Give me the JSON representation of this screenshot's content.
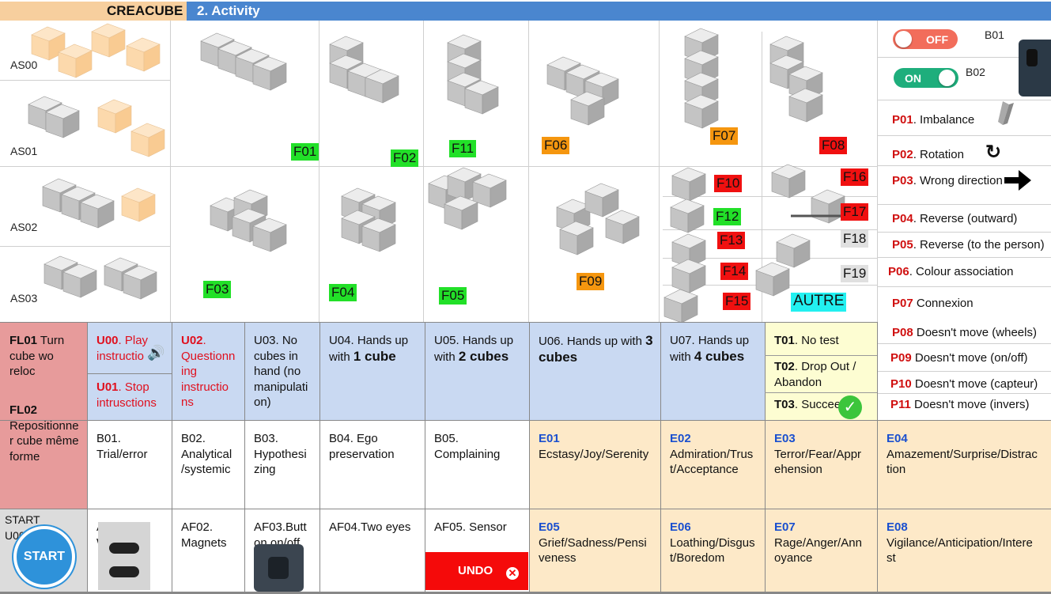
{
  "header": {
    "brand": "CREACUBE",
    "section": "2. Activity"
  },
  "assemblies": [
    "AS00",
    "AS01",
    "AS02",
    "AS03"
  ],
  "figures": {
    "f01": "F01",
    "f02": "F02",
    "f11": "F11",
    "f06": "F06",
    "f07": "F07",
    "f08": "F08",
    "f03": "F03",
    "f04": "F04",
    "f05": "F05",
    "f09": "F09",
    "f10": "F10",
    "f12": "F12",
    "f13": "F13",
    "f14": "F14",
    "f15": "F15",
    "f16": "F16",
    "f17": "F17",
    "f18": "F18",
    "f19": "F19",
    "autre": "AUTRE"
  },
  "toggles": {
    "off_label": "OFF",
    "on_label": "ON",
    "b01": "B01",
    "b02": "B02"
  },
  "problems": [
    {
      "code": "P01",
      "text": ". Imbalance"
    },
    {
      "code": "P02",
      "text": ". Rotation"
    },
    {
      "code": "P03",
      "text": ". Wrong direction"
    },
    {
      "code": "P04",
      "text": ". Reverse (outward)"
    },
    {
      "code": "P05",
      "text": ". Reverse (to the person)"
    },
    {
      "code": "P06",
      "text": ". Colour association"
    },
    {
      "code": "P07",
      "text": " Connexion"
    },
    {
      "code": "P08",
      "text": " Doesn't move (wheels)"
    },
    {
      "code": "P09",
      "text": " Doesn't move (on/off)"
    },
    {
      "code": "P10",
      "text": " Doesn't move (capteur)"
    },
    {
      "code": "P11",
      "text": " Doesn't move (invers)"
    }
  ],
  "fl": {
    "fl01_code": "FL01",
    "fl01_text": " Turn cube wo reloc",
    "fl02_code": "FL02",
    "fl02_text": "Reposit­ionner cube même forme"
  },
  "u": {
    "u00_code": "U00",
    "u00_text": ". Play instructio",
    "u01_code": "U01",
    "u01_text": ". Stop intrusctions",
    "u02_code": "U02",
    "u02_text": ". Questionn ing instructio ns",
    "u03": "U03. No cubes in hand (no manipulati on)",
    "u04_a": "U04. Hands up with ",
    "u04_b": "1 cube",
    "u05_a": "U05. Hands up with ",
    "u05_b": "2 cubes",
    "u06_a": "U06. Hands up with ",
    "u06_b": "3 cubes",
    "u07_a": "U07. Hands up with ",
    "u07_b": "4 cubes"
  },
  "t": {
    "t01_code": "T01",
    "t01_text": ". No test",
    "t02_code": "T02",
    "t02_text": ". Drop Out / Abandon",
    "t03_code": "T03",
    "t03_text": ". Succeed"
  },
  "b": {
    "b01": "B01. Trial/error",
    "b02": "B02. Analytical /systemic",
    "b03": "B03. Hypothesi zing",
    "b04": "B04. Ego preservation",
    "b05": "B05. Complaining"
  },
  "e": [
    {
      "code": "E01",
      "text": "Ecstasy/Joy/Serenity"
    },
    {
      "code": "E02",
      "text": "Admiration/Trus t/Acceptance"
    },
    {
      "code": "E03",
      "text": "Terror/Fear/Appr ehension"
    },
    {
      "code": "E04",
      "text": "Amazement/Surprise/Distrac tion"
    },
    {
      "code": "E05",
      "text": "Grief/Sadness/Pensi veness"
    },
    {
      "code": "E06",
      "text": "Loathing/Disgus t/Boredom"
    },
    {
      "code": "E07",
      "text": "Rage/Anger/Ann oyance"
    },
    {
      "code": "E08",
      "text": "Vigilance/Anticipation/Intere st"
    }
  ],
  "af": {
    "af01": "AF01. Wheels",
    "af02": "AF02. Magnets",
    "af03": "AF03.Butt on on/off",
    "af04": "AF04.Two eyes",
    "af05": "AF05. Sensor"
  },
  "start": {
    "label": "START",
    "code": "U00",
    "button": "START"
  },
  "undo": {
    "label": "UNDO",
    "icon": "x-icon"
  },
  "colors": {
    "header_blue": "#4a86cf",
    "header_peach": "#f7cf9e",
    "u_blue": "#c9d9f2",
    "fl_red": "#e79b9b",
    "t_yellow": "#fdfdd2",
    "e_peach": "#fde9c8",
    "undo_red": "#f50a0a"
  }
}
